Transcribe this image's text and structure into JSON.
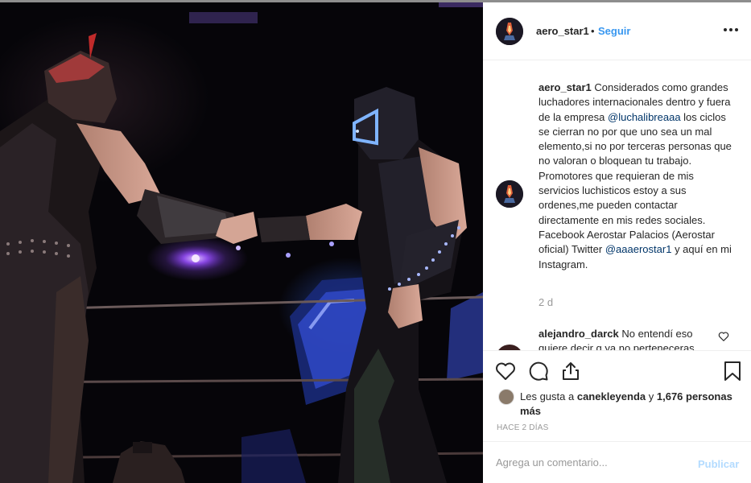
{
  "post": {
    "username": "aero_star1",
    "separator": "•",
    "follow_label": "Seguir",
    "more_icon": "more-horizontal-icon"
  },
  "caption": {
    "author": "aero_star1",
    "text_before_mention": "Considerados como grandes luchadores internacionales dentro y fuera de la empresa",
    "mention_1": "@luchalibreaaa",
    "text_middle": "los ciclos se cierran no por que uno sea un mal elemento,si no por terceras personas que no valoran o bloquean tu trabajo. Promotores que requieran de mis servicios luchisticos estoy a sus ordenes,me pueden contactar directamente en mis redes sociales. Facebook Aerostar Palacios (Aerostar oficial) Twitter",
    "mention_2": "@aaaerostar1",
    "text_after_mention": "y aquí en mi Instagram.",
    "time_ago": "2 d"
  },
  "comment": {
    "author": "alejandro_darck",
    "text": "No entendí eso quiere decir q ya no perteneceras"
  },
  "actions": {
    "like_icon": "heart-icon",
    "comment_icon": "comment-icon",
    "share_icon": "share-icon",
    "save_icon": "bookmark-icon"
  },
  "likes": {
    "prefix": "Les gusta a",
    "liker": "canekleyenda",
    "conjunction": "y",
    "others": "1,676 personas más"
  },
  "posted_at": "HACE 2 DÍAS",
  "add_comment": {
    "placeholder": "Agrega un comentario...",
    "publish_label": "Publicar"
  },
  "colors": {
    "link": "#3897f0",
    "mention": "#003569",
    "publish_disabled": "#b3dbff",
    "secondary_text": "#999999",
    "photo_background": "#060509"
  }
}
